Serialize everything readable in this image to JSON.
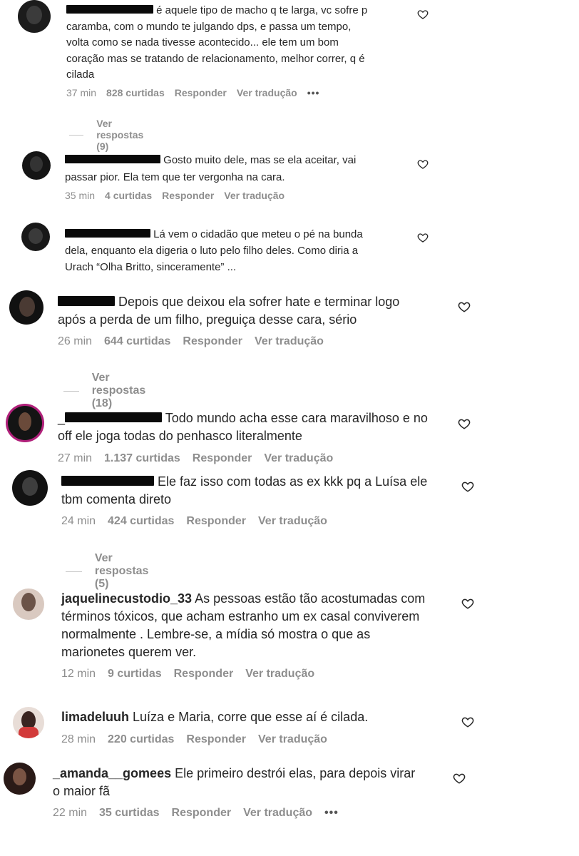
{
  "comments": [
    {
      "username": "",
      "lines": [
        "é aquele tipo de macho q te larga, vc sofre p",
        "caramba, com o mundo te julgando dps, e passa um tempo,",
        "volta como se nada tivesse acontecido... ele tem um bom",
        "coração mas se tratando de relacionamento, melhor correr, q é",
        "cilada"
      ],
      "time": "37 min",
      "likes": "828 curtidas",
      "reply": "Responder",
      "translate": "Ver tradução",
      "more": "•••",
      "view_replies": "Ver respostas (9)"
    },
    {
      "username": "",
      "lines": [
        "Gosto muito dele, mas se ela aceitar, vai",
        "passar pior. Ela tem que ter vergonha na cara."
      ],
      "time": "35 min",
      "likes": "4 curtidas",
      "reply": "Responder",
      "translate": "Ver tradução"
    },
    {
      "username": "",
      "lines": [
        "Lá vem o cidadão que meteu o pé na bunda",
        "dela, enquanto ela digeria o luto pelo filho deles. Como diria a",
        "Urach “Olha Britto, sinceramente” ..."
      ]
    },
    {
      "username": "",
      "lines": [
        "Depois que deixou ela sofrer hate e terminar logo",
        "após a perda de um filho, preguiça desse cara, sério"
      ],
      "time": "26 min",
      "likes": "644 curtidas",
      "reply": "Responder",
      "translate": "Ver tradução",
      "view_replies": "Ver respostas (18)"
    },
    {
      "username": "",
      "lines": [
        "Todo mundo acha esse cara maravilhoso e no",
        "off ele joga todas do penhasco literalmente"
      ],
      "time": "27 min",
      "likes": "1.137 curtidas",
      "reply": "Responder",
      "translate": "Ver tradução"
    },
    {
      "username": "",
      "lines": [
        "Ele faz isso com todas as ex kkk pq a Luísa ele",
        "tbm comenta direto"
      ],
      "time": "24 min",
      "likes": "424 curtidas",
      "reply": "Responder",
      "translate": "Ver tradução",
      "view_replies": "Ver respostas (5)"
    },
    {
      "username": "jaquelinecustodio_33",
      "lines": [
        "As pessoas estão tão acostumadas com",
        "términos tóxicos, que acham estranho um ex casal conviverem",
        "normalmente . Lembre-se, a mídia só mostra o que as",
        "marionetes querem ver."
      ],
      "time": "12 min",
      "likes": "9 curtidas",
      "reply": "Responder",
      "translate": "Ver tradução"
    },
    {
      "username": "limadeluuh",
      "lines": [
        "Luíza e Maria, corre que esse aí é cilada."
      ],
      "time": "28 min",
      "likes": "220 curtidas",
      "reply": "Responder",
      "translate": "Ver tradução"
    },
    {
      "username": "_amanda__gomees",
      "lines": [
        "Ele primeiro destrói elas, para depois virar",
        "o maior fã"
      ],
      "time": "22 min",
      "likes": "35 curtidas",
      "reply": "Responder",
      "translate": "Ver tradução",
      "more": "•••"
    }
  ]
}
